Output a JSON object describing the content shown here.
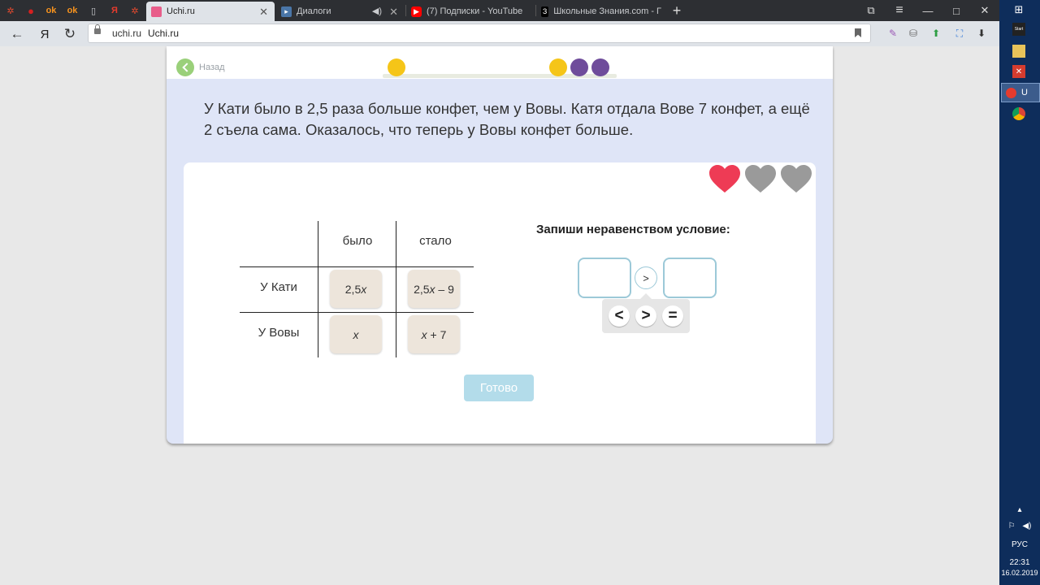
{
  "browser": {
    "pinned_tabs": [
      {
        "icon": "asterisk-icon",
        "label": "✲",
        "color": "#e64a2e"
      },
      {
        "icon": "red-circle-icon",
        "label": "●",
        "color": "#d62020"
      },
      {
        "icon": "ok-icon",
        "label": "ok",
        "color": "#f7931e"
      },
      {
        "icon": "ok-icon",
        "label": "ok",
        "color": "#f7931e"
      },
      {
        "icon": "page-icon",
        "label": "▯",
        "color": "#c9cbce"
      },
      {
        "icon": "yandex-icon",
        "label": "Я",
        "color": "#e63b2e"
      },
      {
        "icon": "asterisk-icon",
        "label": "✲",
        "color": "#e64a2e"
      }
    ],
    "tabs": [
      {
        "title": "Uchi.ru",
        "active": true,
        "fav_color": "#e85d8a"
      },
      {
        "title": "Диалоги",
        "active": false,
        "fav_color": "#4a76a8"
      },
      {
        "title": "(7) Подписки - YouTube",
        "active": false,
        "fav_color": "#ff0000"
      },
      {
        "title": "Школьные Знания.com - Г",
        "active": false,
        "fav_color": "#000000"
      }
    ],
    "new_tab": "+",
    "address": {
      "host": "uchi.ru",
      "page_title": "Uchi.ru"
    },
    "nav": {
      "back": "←",
      "yandex": "Я",
      "reload": "↻"
    },
    "extensions": [
      "✎",
      "⛶",
      "⬇"
    ],
    "window_controls": [
      "⧉",
      "≡",
      "—",
      "□",
      "✕"
    ]
  },
  "page": {
    "back_label": "Назад",
    "progress_dots": [
      {
        "state": "current",
        "color": "#f5c518"
      },
      {
        "state": "done",
        "color": "#f5c518"
      },
      {
        "state": "pending",
        "color": "#6f4c9b"
      },
      {
        "state": "pending",
        "color": "#6f4c9b"
      }
    ],
    "task_text": "У Кати было в 2,5 раза больше конфет, чем у Вовы. Катя отдала Вове 7 конфет, а ещё 2 съела сама. Оказалось, что теперь у Вовы конфет больше.",
    "lives": {
      "remaining": 1,
      "total": 3,
      "full_color": "#ee3b55",
      "empty_color": "#9a9a9a"
    },
    "table": {
      "headers": [
        "было",
        "стало"
      ],
      "rows": [
        {
          "label": "У Кати",
          "before": [
            "2,5",
            "x",
            ""
          ],
          "after": [
            "2,5",
            "x",
            " – 9"
          ]
        },
        {
          "label": "У Вовы",
          "before": [
            "",
            "x",
            ""
          ],
          "after": [
            "",
            "x",
            " + 7"
          ]
        }
      ]
    },
    "instruction": "Запиши неравенством условие:",
    "inequality": {
      "left": "",
      "operator": ">",
      "right": ""
    },
    "operator_choices": [
      "<",
      ">",
      "="
    ],
    "done_button": "Готово"
  },
  "taskbar": {
    "windows_icon": "⊞",
    "active_app": "U",
    "language": "РУС",
    "time": "22:31",
    "date": "16.02.2019",
    "tray_icons": [
      "▴",
      "⚐",
      "🔈"
    ]
  }
}
